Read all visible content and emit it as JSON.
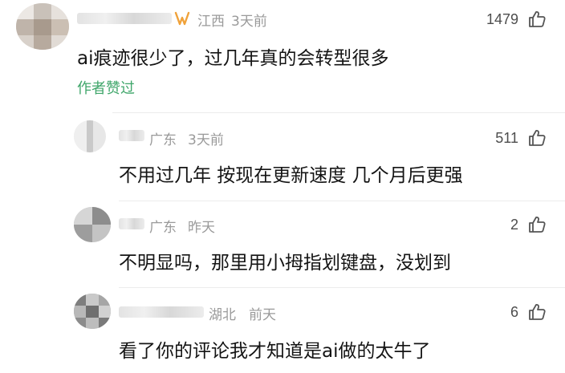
{
  "comments": [
    {
      "location": "江西",
      "time": "3天前",
      "text": "ai痕迹很少了，过几年真的会转型很多",
      "likes": "1479",
      "author_liked": "作者赞过"
    }
  ],
  "replies": [
    {
      "location": "广东",
      "time": "3天前",
      "text": "不用过几年  按现在更新速度  几个月后更强",
      "likes": "511"
    },
    {
      "location": "广东",
      "time": "昨天",
      "text": "不明显吗，那里用小拇指划键盘，没划到",
      "likes": "2"
    },
    {
      "location": "湖北",
      "time": "前天",
      "text": "看了你的评论我才知道是ai做的太牛了",
      "likes": "6"
    }
  ],
  "icons": {
    "like": "thumbs-up-icon",
    "badge": "vip-badge-icon"
  },
  "colors": {
    "author_liked": "#3fa66a",
    "meta": "#9a9a9a"
  }
}
